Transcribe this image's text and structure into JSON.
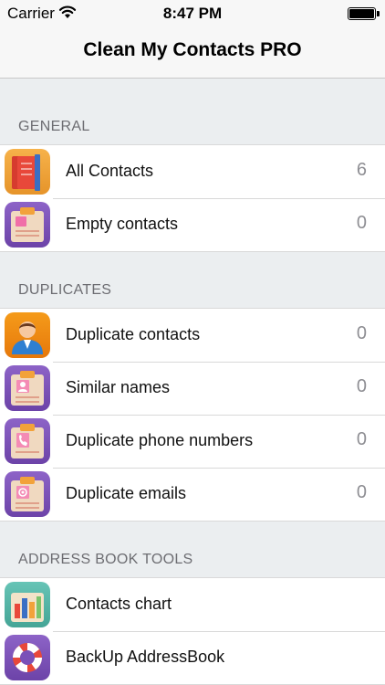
{
  "status_bar": {
    "carrier": "Carrier",
    "time": "8:47 PM"
  },
  "nav": {
    "title": "Clean My Contacts PRO"
  },
  "sections": [
    {
      "header": "GENERAL",
      "rows": [
        {
          "label": "All Contacts",
          "count": "6",
          "icon": "contacts-book-icon"
        },
        {
          "label": "Empty contacts",
          "count": "0",
          "icon": "empty-clipboard-icon"
        }
      ]
    },
    {
      "header": "DUPLICATES",
      "rows": [
        {
          "label": "Duplicate contacts",
          "count": "0",
          "icon": "person-icon"
        },
        {
          "label": "Similar names",
          "count": "0",
          "icon": "contact-card-clipboard-icon"
        },
        {
          "label": "Duplicate phone numbers",
          "count": "0",
          "icon": "phone-clipboard-icon"
        },
        {
          "label": "Duplicate emails",
          "count": "0",
          "icon": "email-clipboard-icon"
        }
      ]
    },
    {
      "header": "ADDRESS BOOK TOOLS",
      "rows": [
        {
          "label": "Contacts chart",
          "icon": "bar-chart-icon"
        },
        {
          "label": "BackUp AddressBook",
          "icon": "lifebuoy-icon"
        }
      ]
    }
  ],
  "colors": {
    "background": "#ebeef0",
    "separator": "#d9d9d9",
    "count_text": "#8e8e93"
  }
}
